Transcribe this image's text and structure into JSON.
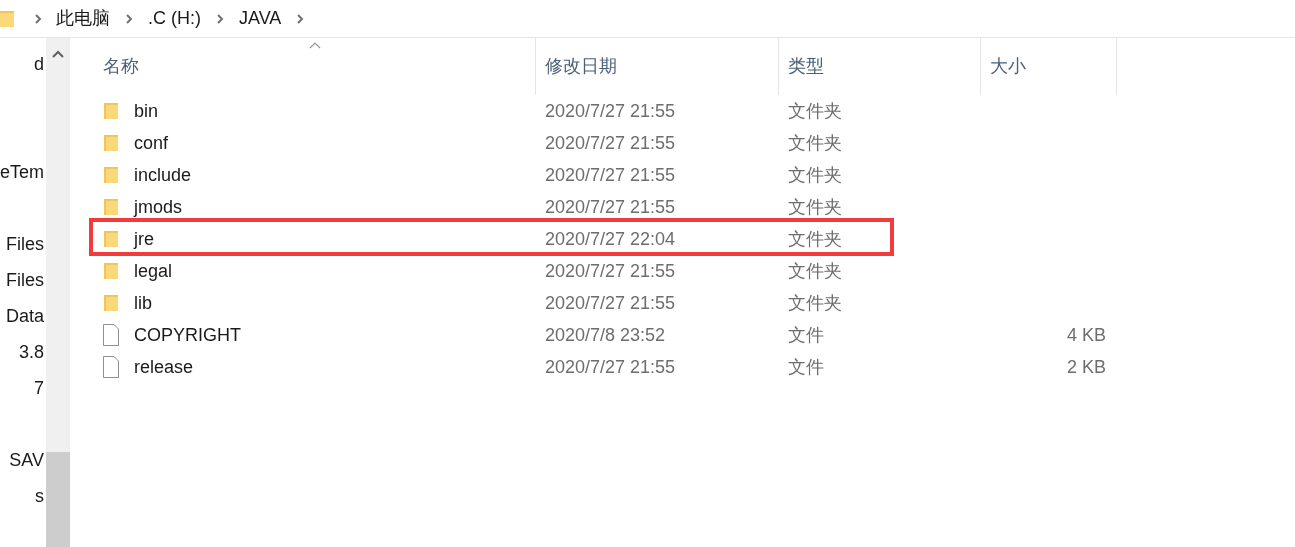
{
  "breadcrumb": [
    "此电脑",
    ".C (H:)",
    "JAVA"
  ],
  "sidebar": {
    "items": [
      "d",
      "eTem",
      "Files",
      "Files",
      "Data",
      "3.8",
      "7",
      "SAV",
      "s"
    ]
  },
  "table": {
    "columns": [
      "名称",
      "修改日期",
      "类型",
      "大小"
    ],
    "rows": [
      {
        "kind": "folder",
        "name": "bin",
        "date": "2020/7/27 21:55",
        "type": "文件夹",
        "highlighted": false
      },
      {
        "kind": "folder",
        "name": "conf",
        "date": "2020/7/27 21:55",
        "type": "文件夹",
        "highlighted": false
      },
      {
        "kind": "folder",
        "name": "include",
        "date": "2020/7/27 21:55",
        "type": "文件夹",
        "highlighted": false
      },
      {
        "kind": "folder",
        "name": "jmods",
        "date": "2020/7/27 21:55",
        "type": "文件夹",
        "highlighted": false
      },
      {
        "kind": "folder",
        "name": "jre",
        "date": "2020/7/27 22:04",
        "type": "文件夹",
        "highlighted": true
      },
      {
        "kind": "folder",
        "name": "legal",
        "date": "2020/7/27 21:55",
        "type": "文件夹",
        "highlighted": false
      },
      {
        "kind": "folder",
        "name": "lib",
        "date": "2020/7/27 21:55",
        "type": "文件夹",
        "highlighted": false
      },
      {
        "kind": "file",
        "name": "COPYRIGHT",
        "date": "2020/7/8 23:52",
        "type": "文件",
        "size": "4 KB",
        "highlighted": false
      },
      {
        "kind": "file",
        "name": "release",
        "date": "2020/7/27 21:55",
        "type": "文件",
        "size": "2 KB",
        "highlighted": false
      }
    ]
  }
}
